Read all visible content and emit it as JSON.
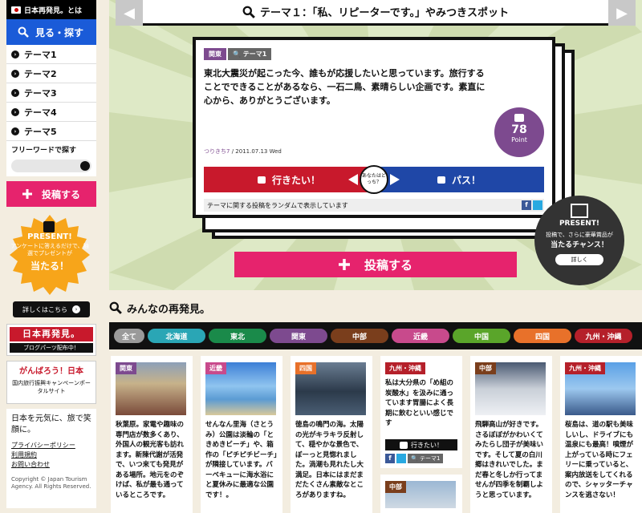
{
  "sidebar": {
    "about": "日本再発見。とは",
    "look": "見る・探す",
    "themes": [
      "テーマ1",
      "テーマ2",
      "テーマ3",
      "テーマ4",
      "テーマ5"
    ],
    "freeword_label": "フリーワードで探す",
    "post": "投稿する",
    "present": {
      "title": "PRESENT!",
      "sub": "アンケートに答えるだけで、抽選でプレゼントが",
      "big": "当たる！",
      "details": "詳しくはこちら"
    },
    "blog_logo": "日本再発見。",
    "blog_caption": "ブログパーツ配布中！",
    "gamba_title": "がんばろう！日本",
    "gamba_sub": "国内旅行振興キャンペーンポータルサイト",
    "info": {
      "slogan": "日本を元気に、旅で笑顔に。",
      "links": [
        "プライバシーポリシー",
        "利用規約",
        "お問い合わせ"
      ],
      "copyright": "Copyright © Japan Tourism Agency. All Rights Reserved."
    }
  },
  "hero": {
    "title": "テーマ１：「私、リピーターです。」やみつきスポット",
    "tag_region": "関東",
    "tag_theme": "テーマ1",
    "text": "東北大震災が起こった今、誰もが応援したいと思っています。旅行することでできることがあるなら、一石二鳥、素晴らしい企画です。素直に心から、ありがとうございます。",
    "user": "つりきち7",
    "date": "/ 2011.07.13 Wed",
    "points": "78",
    "points_label": "Point",
    "want": "行きたい！",
    "pass": "パス！",
    "which": "あなたはどっち？",
    "foot": "テーマに関する投稿をランダムで表示しています",
    "present_title": "PRESENT!",
    "present_sub": "投稿で、さらに豪華賞品が",
    "present_big": "当たるチャンス！",
    "present_btn": "詳しく",
    "post": "投稿する"
  },
  "section_title": "みんなの再発見。",
  "regions": [
    {
      "label": "全て",
      "color": "#9a9a9a"
    },
    {
      "label": "北海道",
      "color": "#2aa6b5"
    },
    {
      "label": "東北",
      "color": "#1a8a4a"
    },
    {
      "label": "関東",
      "color": "#7d4a8f"
    },
    {
      "label": "中部",
      "color": "#7a3e1c"
    },
    {
      "label": "近畿",
      "color": "#c84a8c"
    },
    {
      "label": "中国",
      "color": "#5aa52a"
    },
    {
      "label": "四国",
      "color": "#e8712a"
    },
    {
      "label": "九州・沖縄",
      "color": "#b5202a"
    }
  ],
  "posts": [
    {
      "region": "関東",
      "color": "#7d4a8f",
      "text": "秋葉原。家電や趣味の専門店が数多くあり、外国人の観光客も訪れます。新陳代謝が活発で、いつ来ても発見がある場所。地元をのぞけば、私が最も通っているところです。"
    },
    {
      "region": "近畿",
      "color": "#c84a8c",
      "text": "せんなん里海（さとうみ）公園は淡輪の「ときめきビーチ」や、箱作の「ピチピチビーチ」が隣接しています。バーベキューに海水浴にと夏休みに最適な公園です！。"
    },
    {
      "region": "四国",
      "color": "#e8712a",
      "text": "徳島の鳴門の海。太陽の光がキラキラ反射して、穏やかな景色で、ぼーっと見惚れました。渦潮も見れたし大満足。日本にはまだまだたくさん素敵なところがありますね。"
    },
    {
      "region": "九州・沖縄",
      "color": "#b5202a",
      "text": "私は大分県の「め組の炭酸水」を汲みに通っています胃腸によく長期に飲むといい感じです",
      "want": "行きたい！",
      "theme": "テーマ1"
    },
    {
      "region": "中部",
      "color": "#7a3e1c",
      "text": "飛騨高山が好きです。さるぼぼがかわいくてみたらし団子が美味いです。そして夏の白川郷はきれいでした。まだ春と冬しか行ってませんが四季を制覇しようと思っています。"
    },
    {
      "region": "九州・沖縄",
      "color": "#b5202a",
      "text": "桜島は、道の駅も美味しいし、ドライブにも温泉にも最高！噴煙が上がっている時にフェリーに乗っていると、案内放送をしてくれるので、シャッターチャンスを逃さない！"
    },
    {
      "region": "中部",
      "color": "#7a3e1c"
    }
  ]
}
